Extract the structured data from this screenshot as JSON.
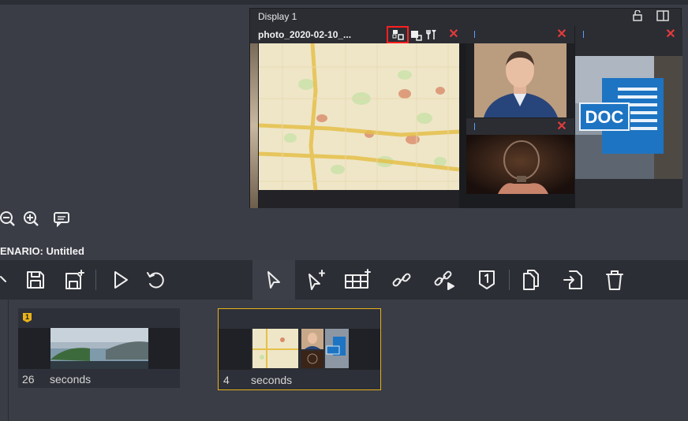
{
  "display_window": {
    "title": "Display 1",
    "panes": [
      {
        "title": "photo_2020-02-10_..."
      },
      {
        "title": ""
      },
      {
        "title": ""
      },
      {
        "title": ""
      }
    ]
  },
  "scenario": {
    "label": "ENARIO: Untitled"
  },
  "zoom": {
    "zoom_out": "zoom-out",
    "zoom_in": "zoom-in",
    "comment": "comment"
  },
  "toolbar": {
    "left": [
      "undo-icon",
      "save-icon",
      "save-as-icon",
      "play-icon",
      "revert-icon"
    ],
    "tools": [
      "pointer-icon",
      "add-pointer-icon",
      "add-grid-icon",
      "link-icon",
      "link-play-icon",
      "marker-icon"
    ],
    "right": [
      "copy-icon",
      "paste-icon",
      "delete-icon"
    ]
  },
  "slides": [
    {
      "badge": "1",
      "duration": "26",
      "unit": "seconds"
    },
    {
      "badge": "",
      "duration": "4",
      "unit": "seconds"
    }
  ],
  "colors": {
    "accent": "#e8b21a",
    "close": "#e23b3b",
    "highlight": "#ff1f1f"
  }
}
